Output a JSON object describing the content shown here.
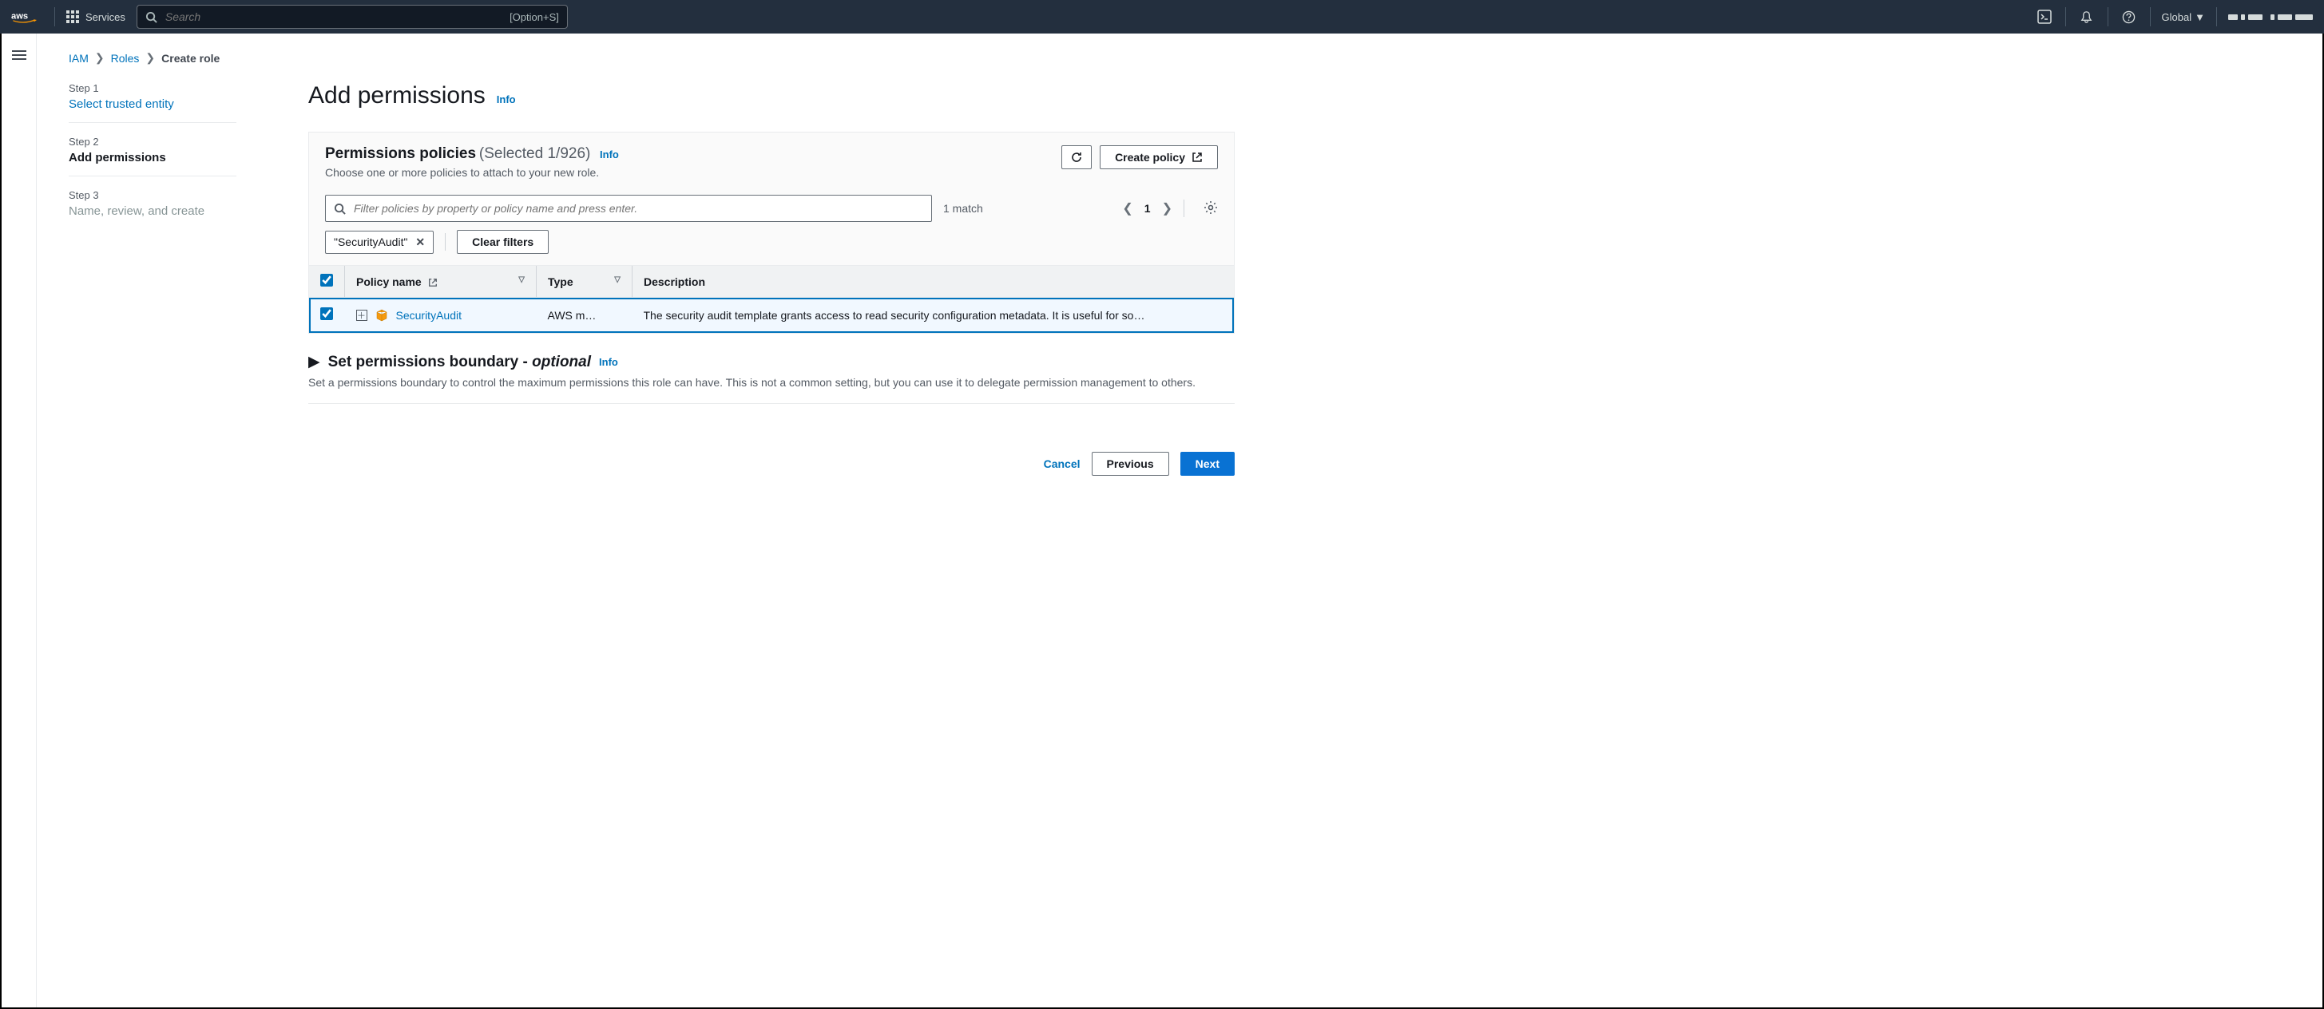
{
  "topnav": {
    "services_label": "Services",
    "search_placeholder": "Search",
    "search_shortcut": "[Option+S]",
    "region": "Global"
  },
  "breadcrumb": {
    "items": [
      "IAM",
      "Roles"
    ],
    "current": "Create role"
  },
  "steps": [
    {
      "num": "Step 1",
      "title": "Select trusted entity",
      "state": "link"
    },
    {
      "num": "Step 2",
      "title": "Add permissions",
      "state": "active"
    },
    {
      "num": "Step 3",
      "title": "Name, review, and create",
      "state": "disabled"
    }
  ],
  "page": {
    "title": "Add permissions",
    "info": "Info"
  },
  "panel": {
    "title": "Permissions policies",
    "count": "(Selected 1/926)",
    "info": "Info",
    "desc": "Choose one or more policies to attach to your new role.",
    "refresh_label": "Refresh",
    "create_label": "Create policy"
  },
  "filter": {
    "placeholder": "Filter policies by property or policy name and press enter.",
    "match_text": "1 match",
    "page_num": "1",
    "chip_value": "\"SecurityAudit\"",
    "clear_label": "Clear filters"
  },
  "table": {
    "headers": {
      "policy_name": "Policy name",
      "type": "Type",
      "description": "Description"
    },
    "rows": [
      {
        "checked": true,
        "name": "SecurityAudit",
        "type": "AWS m…",
        "description": "The security audit template grants access to read security configuration metadata. It is useful for so…"
      }
    ]
  },
  "boundary": {
    "title_bold": "Set permissions boundary - ",
    "title_opt": "optional",
    "info": "Info",
    "desc": "Set a permissions boundary to control the maximum permissions this role can have. This is not a common setting, but you can use it to delegate permission management to others."
  },
  "footer": {
    "cancel": "Cancel",
    "previous": "Previous",
    "next": "Next"
  }
}
